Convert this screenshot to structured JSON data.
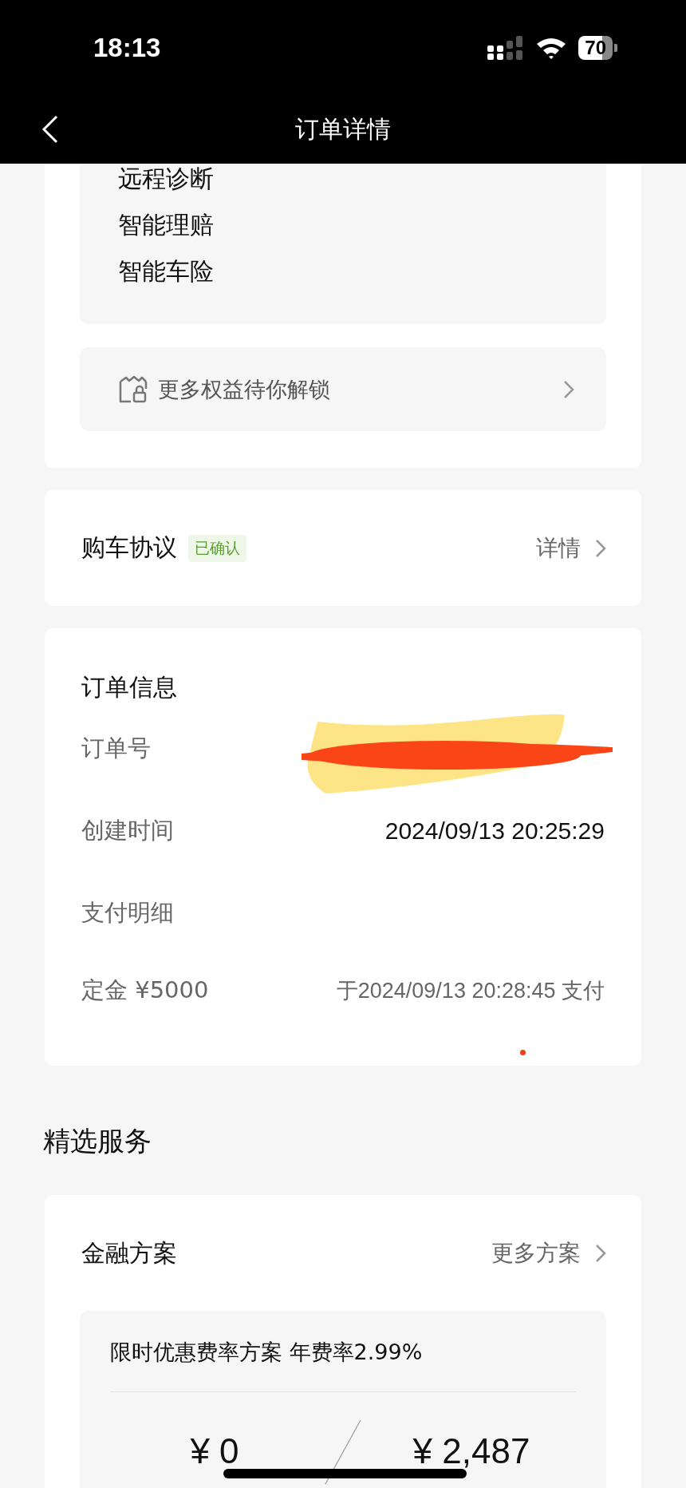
{
  "status_bar": {
    "time": "18:13",
    "battery": "70"
  },
  "nav": {
    "title": "订单详情"
  },
  "benefits": {
    "items": [
      "远程诊断",
      "智能理赔",
      "智能车险"
    ],
    "unlock_link": "更多权益待你解锁"
  },
  "agreement": {
    "title": "购车协议",
    "badge": "已确认",
    "link": "详情"
  },
  "order_info": {
    "title": "订单信息",
    "rows": [
      {
        "label": "订单号",
        "kind": "redacted"
      },
      {
        "label": "创建时间",
        "value": "2024/09/13 20:25:29",
        "kind": "text"
      },
      {
        "label": "支付明细",
        "kind": "heading"
      },
      {
        "label": "定金 ¥5000",
        "value": "于2024/09/13 20:28:45 支付",
        "kind": "payment"
      }
    ]
  },
  "services": {
    "title": "精选服务",
    "finance": {
      "title": "金融方案",
      "more": "更多方案",
      "plan": "限时优惠费率方案 年费率2.99%",
      "amounts": [
        "¥ 0",
        "¥ 2,487"
      ]
    }
  }
}
